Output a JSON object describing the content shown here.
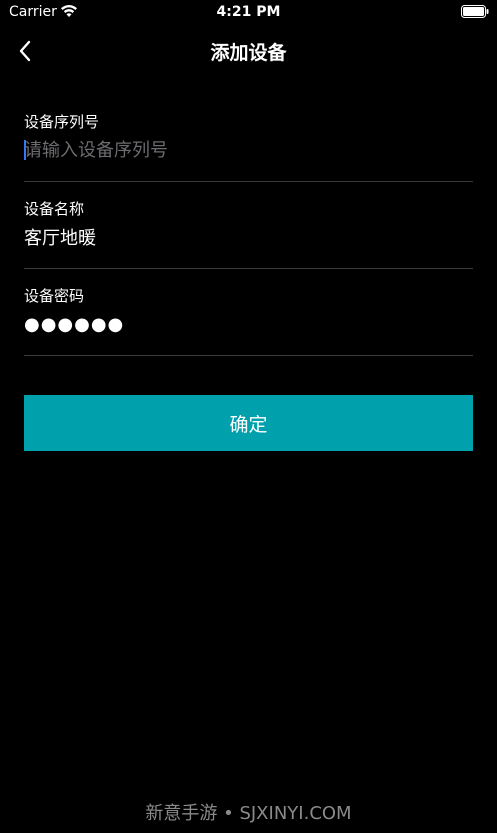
{
  "status_bar": {
    "carrier": "Carrier",
    "time": "4:21 PM",
    "wifi_icon": "wifi-icon",
    "battery_icon": "battery-icon"
  },
  "nav": {
    "title": "添加设备",
    "back_icon": "chevron-left-icon"
  },
  "form": {
    "serial": {
      "label": "设备序列号",
      "placeholder": "请输入设备序列号",
      "value": ""
    },
    "name": {
      "label": "设备名称",
      "value": "客厅地暖"
    },
    "password": {
      "label": "设备密码",
      "value": "●●●●●●"
    }
  },
  "confirm_label": "确定",
  "watermark": "新意手游 • SJXINYI.COM",
  "colors": {
    "background": "#000000",
    "accent": "#00a0ad",
    "divider": "#3a3a3c",
    "placeholder": "#6c6c70",
    "caret": "#3478f6"
  }
}
